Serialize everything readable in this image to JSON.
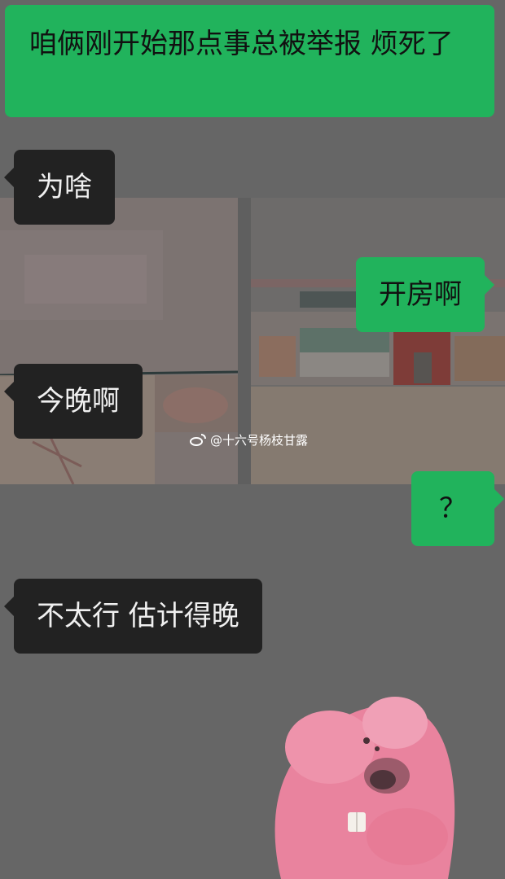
{
  "messages": [
    {
      "side": "right",
      "text": "咱俩刚开始那点事总被举报 烦死了"
    },
    {
      "side": "left",
      "text": "为啥"
    },
    {
      "side": "right",
      "text": "开房啊"
    },
    {
      "side": "left",
      "text": "今晚啊"
    },
    {
      "side": "right",
      "text": "？"
    },
    {
      "side": "left",
      "text": "不太行 估计得晚"
    }
  ],
  "watermark": {
    "text": "@十六号杨枝甘露"
  },
  "colors": {
    "background": "#666666",
    "sent_bubble": "#21b35c",
    "received_bubble": "#222222"
  },
  "sticker": {
    "icon": "pink-beaver-sticker"
  }
}
